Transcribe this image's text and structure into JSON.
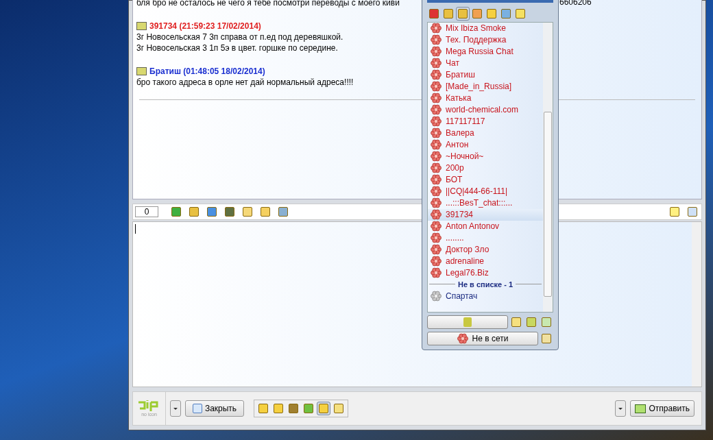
{
  "chat": {
    "messages": [
      {
        "lines": [
          "бля бро не осталось не чего я тебе посмотри переводы с моего киви"
        ]
      },
      {
        "author": "391734",
        "time": "(21:59:23 17/02/2014)",
        "color": "#e02020",
        "lines": [
          "3г Новосельская 7 3п справа от п.ед под деревяшкой.",
          "3г Новосельская 3 1п 5э в цвет. горшке по середине."
        ]
      },
      {
        "author": "Братиш",
        "time": "(01:48:05 18/02/2014)",
        "color": "#1a2fd0",
        "lines": [
          "бро такого адреса в орле нет дай нормальный адреса!!!!"
        ]
      }
    ],
    "cut_tail": "6606206",
    "char_count": "0",
    "input_tools": [
      {
        "pressed": false
      },
      {
        "pressed": false
      },
      {
        "pressed": false
      },
      {
        "pressed": false
      },
      {
        "pressed": false
      },
      {
        "pressed": false
      },
      {
        "pressed": false
      }
    ],
    "logo_caption": "no icon",
    "close_button": "Закрыть",
    "bottom_tools": [
      {
        "pressed": false
      },
      {
        "pressed": false
      },
      {
        "pressed": false
      },
      {
        "pressed": false
      },
      {
        "pressed": true
      },
      {
        "pressed": false
      }
    ],
    "send_button": "Отправить"
  },
  "contact_list": {
    "tools": [
      {
        "pressed": false
      },
      {
        "pressed": false
      },
      {
        "pressed": true
      },
      {
        "pressed": false
      },
      {
        "pressed": false
      },
      {
        "pressed": false
      },
      {
        "pressed": false
      }
    ],
    "contacts": [
      {
        "name": "Mix Ibiza  Smoke",
        "selected": false
      },
      {
        "name": "Тех. Поддержка",
        "selected": false
      },
      {
        "name": "Mega Russia Chat",
        "selected": false
      },
      {
        "name": "Чат",
        "selected": false
      },
      {
        "name": "Братиш",
        "selected": false
      },
      {
        "name": "[Made_in_Russia]",
        "selected": false
      },
      {
        "name": "Катька",
        "selected": false
      },
      {
        "name": "world-chemical.com",
        "selected": false
      },
      {
        "name": "117117117",
        "selected": false
      },
      {
        "name": "Валера",
        "selected": false
      },
      {
        "name": "Антон",
        "selected": false
      },
      {
        "name": "~Ночной~",
        "selected": false
      },
      {
        "name": "200р",
        "selected": false
      },
      {
        "name": "БОТ",
        "selected": false
      },
      {
        "name": "||CQ|444-66-111|",
        "selected": false
      },
      {
        "name": "...:::BesT_chat:::...",
        "selected": false
      },
      {
        "name": "391734",
        "selected": true
      },
      {
        "name": "Anton Antonov",
        "selected": false
      },
      {
        "name": "........",
        "selected": false
      },
      {
        "name": "Доктор  Зло",
        "selected": false
      },
      {
        "name": "adrenaline",
        "selected": false
      },
      {
        "name": "Legal76.Biz",
        "selected": false
      }
    ],
    "not_in_list": {
      "header": "Не в списке - 1",
      "contacts": [
        {
          "name": "Спартач",
          "selected": false
        }
      ]
    },
    "status_button": "Не в сети"
  }
}
